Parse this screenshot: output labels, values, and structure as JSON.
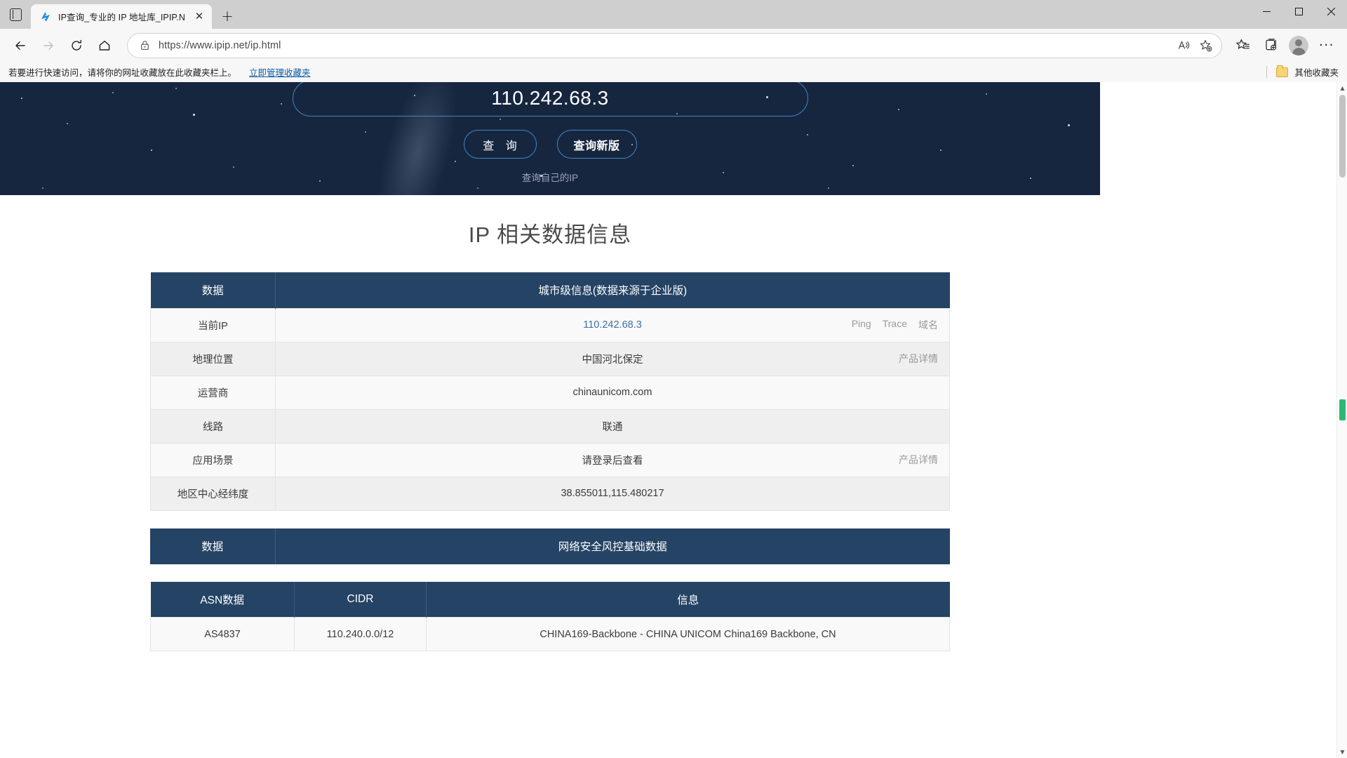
{
  "browser": {
    "tab": {
      "title": "IP查询_专业的 IP 地址库_IPIP.NET",
      "favicon_name": "ipip-logo-icon",
      "close_label": "✕"
    },
    "new_tab_label": "+",
    "tab_search_name": "tab-search-icon",
    "window_controls": {
      "minimize": "—",
      "maximize": "▢",
      "close": "✕"
    },
    "nav": {
      "back": "←",
      "forward": "→",
      "refresh": "⟳",
      "home": "⌂"
    },
    "omnibox": {
      "url": "https://www.ipip.net/ip.html",
      "lock_name": "lock-icon",
      "read_aloud_name": "read-aloud-icon",
      "add_favorite_name": "add-favorite-star-icon"
    },
    "toolbar_icons": {
      "favorites": "favorites-star-list-icon",
      "collections": "collections-icon",
      "profile": "profile-avatar",
      "settings": "···"
    },
    "bookmarks_bar": {
      "note": "若要进行快速访问，请将你的网址收藏放在此收藏夹栏上。",
      "manage_link": "立即管理收藏夹",
      "other_favorites": "其他收藏夹"
    }
  },
  "hero": {
    "ip_value": "110.242.68.3",
    "query_button": "查 询",
    "query_new_button": "查询新版",
    "self_ip_link": "查询自己的IP"
  },
  "page": {
    "title": "IP 相关数据信息"
  },
  "table_city": {
    "headers": {
      "label": "数据",
      "value": "城市级信息(数据来源于企业版)"
    },
    "rows": [
      {
        "label": "当前IP",
        "value": "110.242.68.3",
        "value_is_link": true,
        "actions": [
          "Ping",
          "Trace",
          "域名"
        ]
      },
      {
        "label": "地理位置",
        "value": "中国河北保定",
        "value_is_link": false,
        "actions": [
          "产品详情"
        ]
      },
      {
        "label": "运营商",
        "value": "chinaunicom.com",
        "value_is_link": false,
        "actions": []
      },
      {
        "label": "线路",
        "value": "联通",
        "value_is_link": false,
        "actions": []
      },
      {
        "label": "应用场景",
        "value": "请登录后查看",
        "value_is_link": false,
        "actions": [
          "产品详情"
        ]
      },
      {
        "label": "地区中心经纬度",
        "value": "38.855011,115.480217",
        "value_is_link": false,
        "actions": []
      }
    ]
  },
  "table_security": {
    "headers": {
      "label": "数据",
      "value": "网络安全风控基础数据"
    }
  },
  "table_asn": {
    "headers": {
      "asn": "ASN数据",
      "cidr": "CIDR",
      "info": "信息"
    },
    "rows": [
      {
        "asn": "AS4837",
        "cidr": "110.240.0.0/12",
        "info": "CHINA169-Backbone - CHINA UNICOM China169 Backbone, CN"
      }
    ]
  },
  "scrollbar": {
    "up": "▲",
    "down": "▼"
  },
  "colors": {
    "header_navy": "#254364",
    "hero_bg": "#17263f",
    "accent_blue": "#3f86c4",
    "link_blue": "#3f6fa8",
    "row_odd": "#f9f9f9",
    "row_even": "#efefef"
  }
}
